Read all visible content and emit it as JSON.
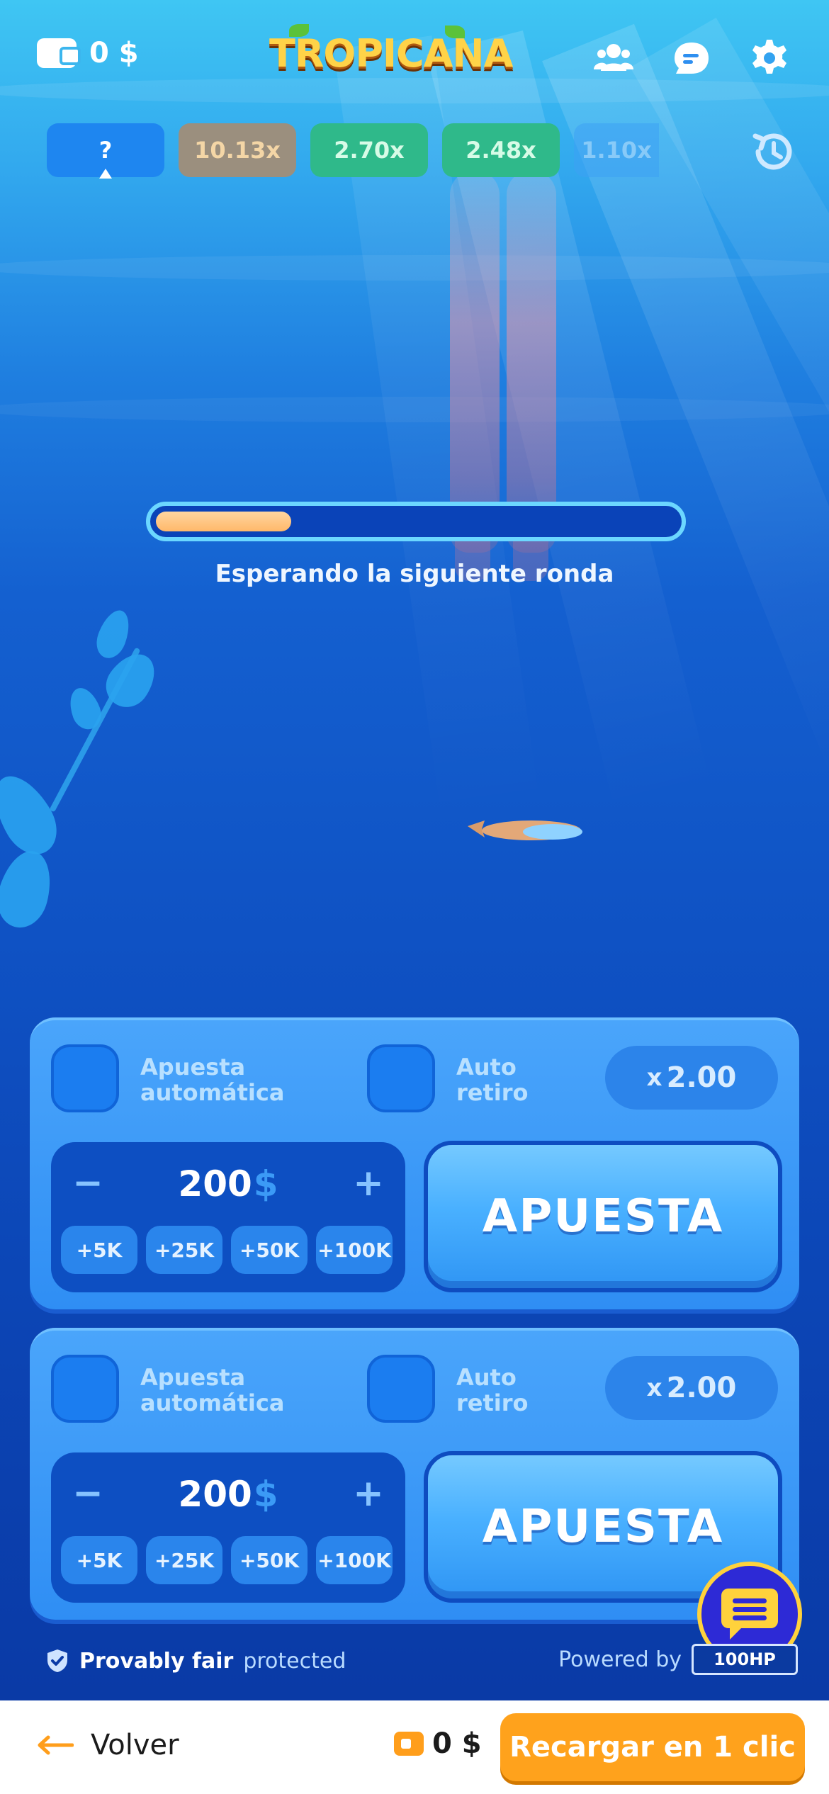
{
  "header": {
    "wallet_amount": "0 $",
    "logo_text": "TROPICANA",
    "icons": [
      "users-icon",
      "chat-icon",
      "gear-icon"
    ]
  },
  "multipliers": {
    "current": "?",
    "history": [
      {
        "value": "10.13x",
        "bg": "#9b8f7e",
        "color": "#f4d6a6"
      },
      {
        "value": "2.70x",
        "bg": "#2fb98a",
        "color": "#d7fbe7"
      },
      {
        "value": "2.48x",
        "bg": "#2fb98a",
        "color": "#d7fbe7"
      },
      {
        "value": "1.10x",
        "bg": "#3da1f5",
        "color": "#b9dcff"
      }
    ]
  },
  "round": {
    "progress": 0.26,
    "status_text": "Esperando la siguiente ronda"
  },
  "bet_panels": [
    {
      "auto_bet_label_1": "Apuesta",
      "auto_bet_label_2": "automática",
      "auto_cashout_label_1": "Auto",
      "auto_cashout_label_2": "retiro",
      "multiplier_prefix": "x",
      "multiplier_value": "2.00",
      "minus": "−",
      "plus": "+",
      "stake": "200",
      "currency": "$",
      "quick": [
        "+5K",
        "+25K",
        "+50K",
        "+100K"
      ],
      "bet_label": "APUESTA"
    },
    {
      "auto_bet_label_1": "Apuesta",
      "auto_bet_label_2": "automática",
      "auto_cashout_label_1": "Auto",
      "auto_cashout_label_2": "retiro",
      "multiplier_prefix": "x",
      "multiplier_value": "2.00",
      "minus": "−",
      "plus": "+",
      "stake": "200",
      "currency": "$",
      "quick": [
        "+5K",
        "+25K",
        "+50K",
        "+100K"
      ],
      "bet_label": "APUESTA"
    }
  ],
  "footer": {
    "fair_bold": "Provably fair",
    "fair_normal": "protected",
    "powered_by": "Powered by",
    "provider_logo": "100HP"
  },
  "bottom_bar": {
    "back_label": "Volver",
    "balance": "0 $",
    "recharge_label": "Recargar en 1 clic"
  }
}
